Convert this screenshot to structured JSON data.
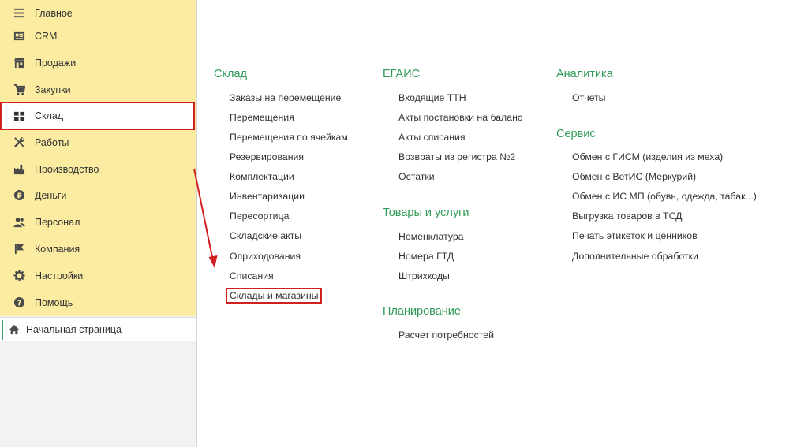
{
  "sidebar": {
    "items": [
      {
        "label": "Главное",
        "icon": "menu-icon"
      },
      {
        "label": "CRM",
        "icon": "crm-card-icon"
      },
      {
        "label": "Продажи",
        "icon": "shop-icon"
      },
      {
        "label": "Закупки",
        "icon": "cart-icon"
      },
      {
        "label": "Склад",
        "icon": "warehouse-grid-icon"
      },
      {
        "label": "Работы",
        "icon": "tools-icon"
      },
      {
        "label": "Производство",
        "icon": "factory-icon"
      },
      {
        "label": "Деньги",
        "icon": "money-icon"
      },
      {
        "label": "Персонал",
        "icon": "people-icon"
      },
      {
        "label": "Компания",
        "icon": "flag-icon"
      },
      {
        "label": "Настройки",
        "icon": "gear-icon"
      },
      {
        "label": "Помощь",
        "icon": "help-icon"
      }
    ],
    "selected": "Склад",
    "home": {
      "label": "Начальная страница",
      "icon": "home-icon"
    }
  },
  "sections": {
    "sklad": {
      "title": "Склад",
      "links": [
        "Заказы на перемещение",
        "Перемещения",
        "Перемещения по ячейкам",
        "Резервирования",
        "Комплектации",
        "Инвентаризации",
        "Пересортица",
        "Складские акты",
        "Оприходования",
        "Списания",
        "Склады и магазины"
      ]
    },
    "egais": {
      "title": "ЕГАИС",
      "links": [
        "Входящие ТТН",
        "Акты постановки на баланс",
        "Акты списания",
        "Возвраты из регистра №2",
        "Остатки"
      ]
    },
    "goods": {
      "title": "Товары и услуги",
      "links": [
        "Номенклатура",
        "Номера ГТД",
        "Штрихкоды"
      ]
    },
    "planning": {
      "title": "Планирование",
      "links": [
        "Расчет потребностей"
      ]
    },
    "analytics": {
      "title": "Аналитика",
      "links": [
        "Отчеты"
      ]
    },
    "service": {
      "title": "Сервис",
      "links": [
        "Обмен с ГИСМ (изделия из меха)",
        "Обмен с ВетИС (Меркурий)",
        "Обмен с ИС МП (обувь, одежда, табак...)",
        "Выгрузка товаров в ТСД",
        "Печать этикеток и ценников",
        "Дополнительные обработки"
      ]
    }
  },
  "colors": {
    "sidebar_bg": "#fbeca2",
    "section_title": "#2e9a55",
    "highlight": "#d21f1f",
    "accent": "#3a9b63"
  }
}
